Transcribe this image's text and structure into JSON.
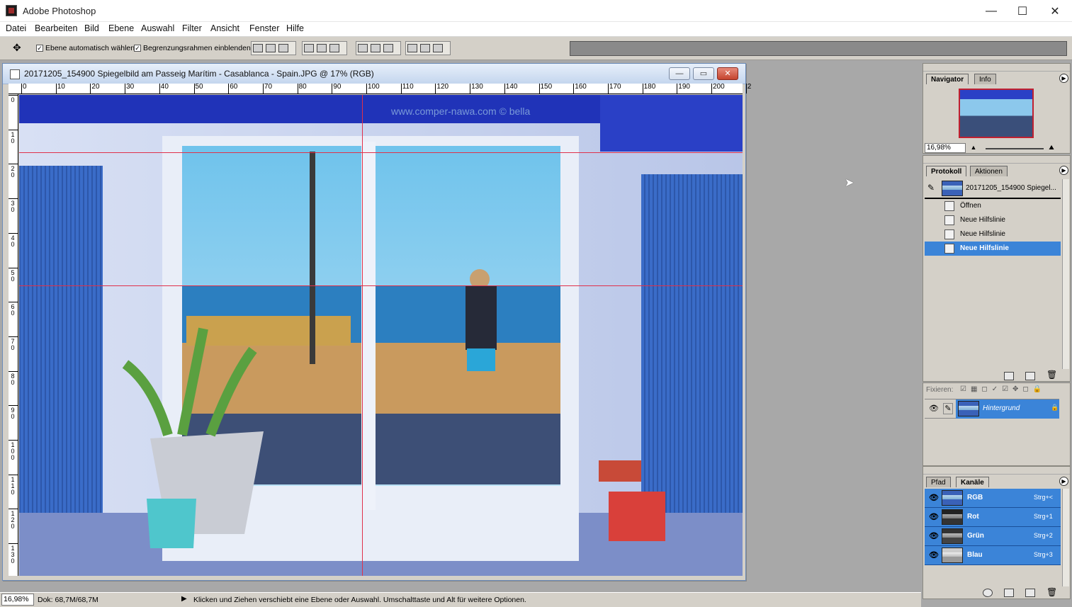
{
  "app": {
    "title": "Adobe Photoshop"
  },
  "window_controls": {
    "minimize": "—",
    "maximize": "☐",
    "close": "✕"
  },
  "menu": [
    "Datei",
    "Bearbeiten",
    "Bild",
    "Ebene",
    "Auswahl",
    "Filter",
    "Ansicht",
    "Fenster",
    "Hilfe"
  ],
  "options": {
    "move_tool_icon": "move-tool-icon",
    "auto_select_label": "Ebene automatisch wählen",
    "auto_select_checked": true,
    "show_bounds_label": "Begrenzungsrahmen einblenden",
    "show_bounds_checked": true
  },
  "document": {
    "title": "20171205_154900 Spiegelbild am Passeig Marítim - Casablanca - Spain.JPG @ 17% (RGB)",
    "watermark": "www.comper-nawa.com © bella"
  },
  "ruler": {
    "top_labels": [
      "0",
      "10",
      "20",
      "30",
      "40",
      "50",
      "60",
      "70",
      "80",
      "90",
      "100",
      "110",
      "120",
      "130",
      "140",
      "150",
      "160",
      "170",
      "180",
      "190",
      "200",
      "2"
    ],
    "left_labels": [
      "0",
      "1 0",
      "2 0",
      "3 0",
      "4 0",
      "5 0",
      "6 0",
      "7 0",
      "8 0",
      "9 0",
      "1 0 0",
      "1 1 0",
      "1 2 0",
      "1 3 0"
    ]
  },
  "navigator": {
    "tabs": [
      "Navigator",
      "Info"
    ],
    "zoom": "16,98%"
  },
  "history": {
    "tabs": [
      "Protokoll",
      "Aktionen"
    ],
    "snapshot": "20171205_154900 Spiegel...",
    "steps": [
      "Öffnen",
      "Neue Hilfslinie",
      "Neue Hilfslinie",
      "Neue Hilfslinie"
    ],
    "active_index": 3
  },
  "layers": {
    "lock_label": "Fixieren:",
    "layer_name": "Hintergrund"
  },
  "channels": {
    "tabs": [
      "Pfad",
      "Kanäle"
    ],
    "rows": [
      {
        "name": "RGB",
        "shortcut": "Strg+<"
      },
      {
        "name": "Rot",
        "shortcut": "Strg+1"
      },
      {
        "name": "Grün",
        "shortcut": "Strg+2"
      },
      {
        "name": "Blau",
        "shortcut": "Strg+3"
      }
    ]
  },
  "status": {
    "zoom": "16,98%",
    "doc": "Dok: 68,7M/68,7M",
    "hint": "Klicken und Ziehen verschiebt eine Ebene oder Auswahl. Umschalttaste und Alt für weitere Optionen."
  }
}
